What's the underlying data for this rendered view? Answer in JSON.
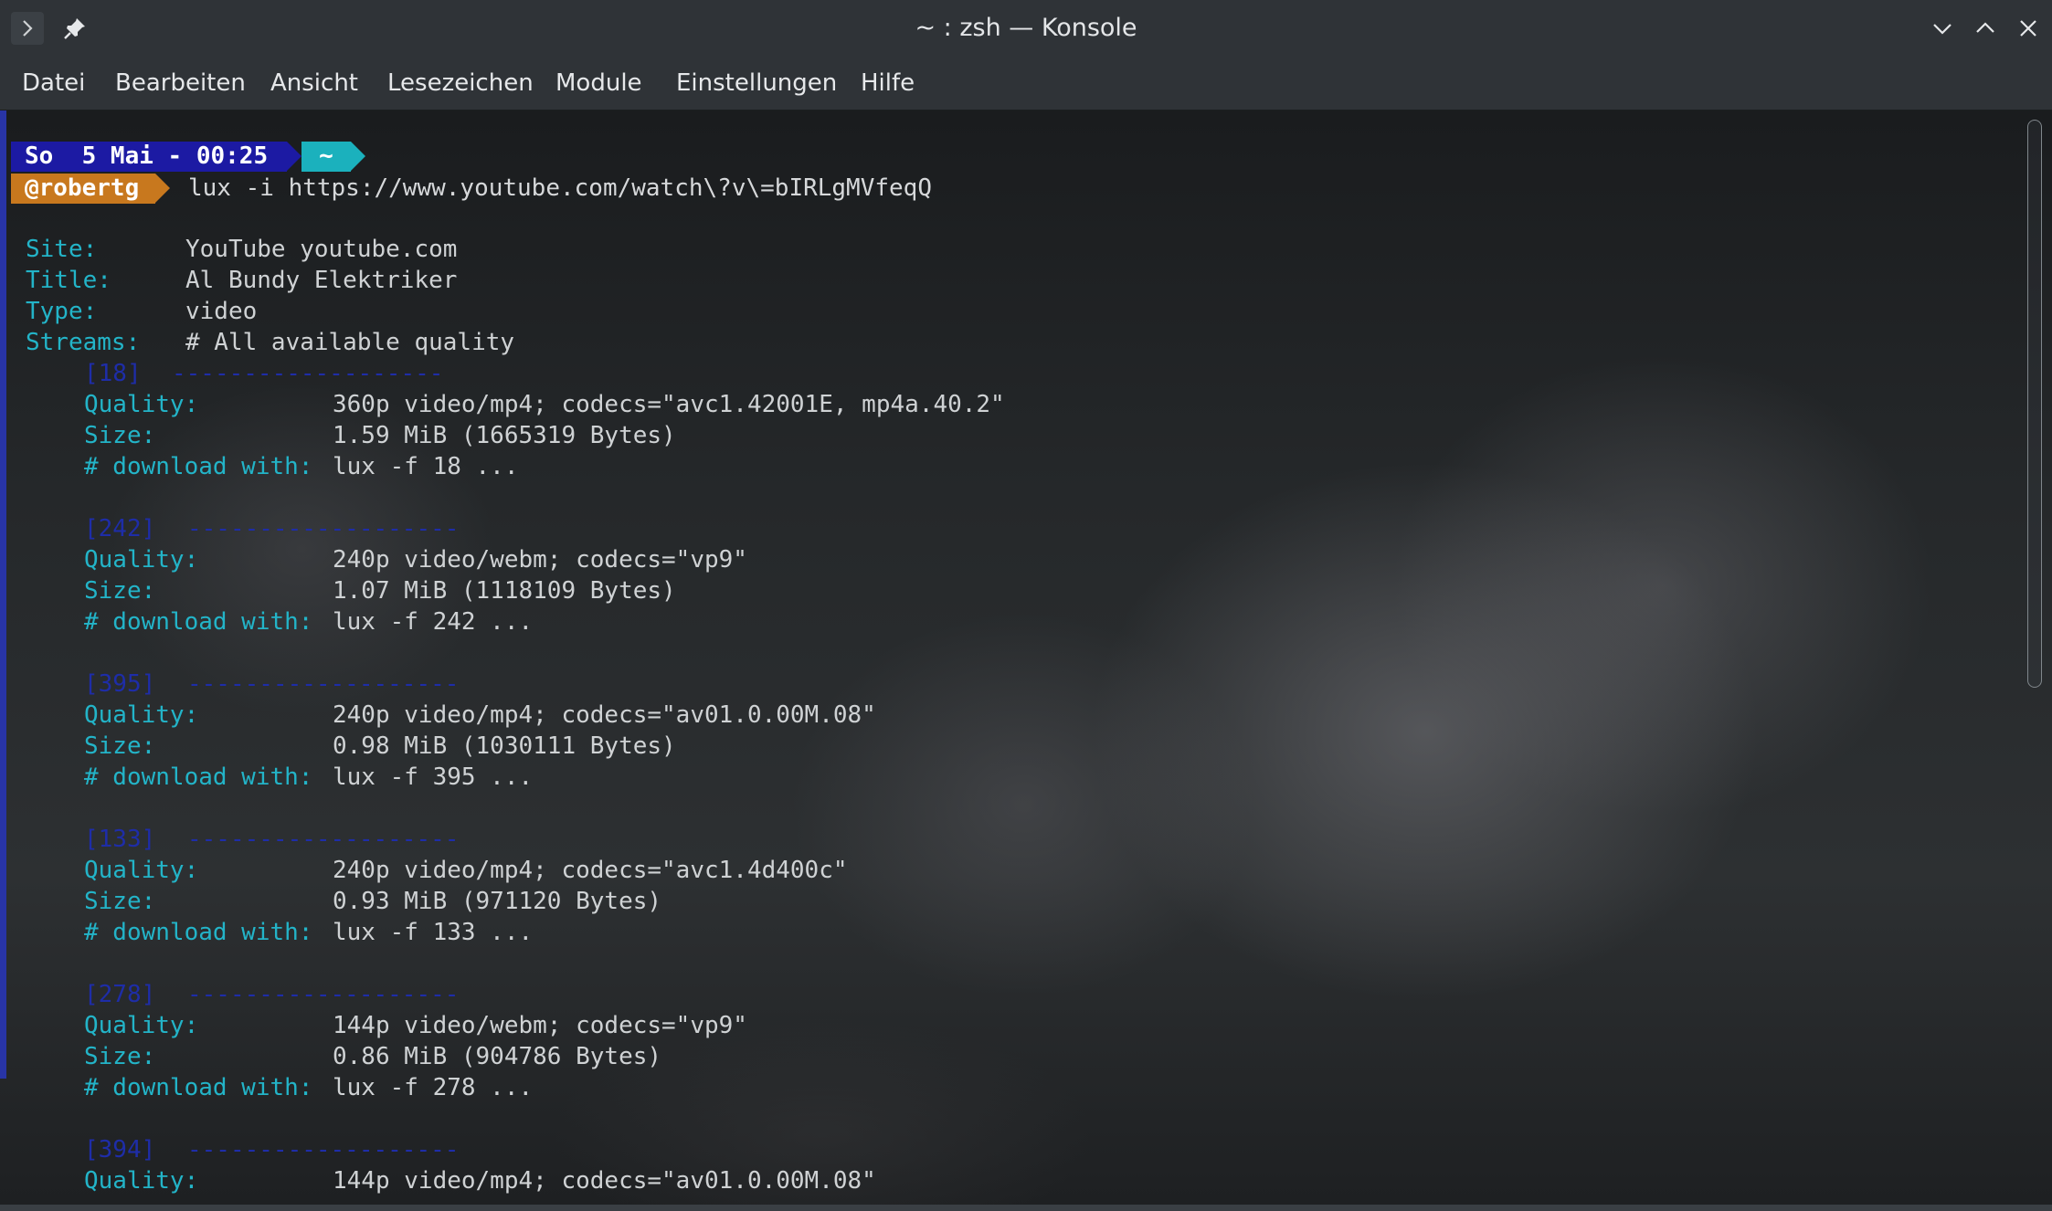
{
  "window": {
    "title": "~ : zsh — Konsole",
    "left_icons": [
      "terminal-menu-icon",
      "pin-icon"
    ],
    "right_icons": [
      "minimize-icon",
      "maximize-icon",
      "close-icon"
    ]
  },
  "menubar": {
    "items": [
      "Datei",
      "Bearbeiten",
      "Ansicht",
      "Lesezeichen",
      "Module",
      "Einstellungen",
      "Hilfe"
    ]
  },
  "prompt": {
    "datetime": "So  5 Mai - 00:25",
    "dir": "~",
    "user": "@robertg",
    "command": "lux -i https://www.youtube.com/watch\\?v\\=bIRLgMVfeqQ"
  },
  "info": [
    {
      "label": "Site:",
      "value": "YouTube youtube.com"
    },
    {
      "label": "Title:",
      "value": "Al Bundy Elektriker"
    },
    {
      "label": "Type:",
      "value": "video"
    },
    {
      "label": "Streams:",
      "value": "# All available quality"
    }
  ],
  "stream_labels": {
    "quality": "Quality:",
    "size": "Size:",
    "download": "# download with:"
  },
  "streams": [
    {
      "id": "[18]",
      "separator": "-------------------",
      "quality": "360p video/mp4; codecs=\"avc1.42001E, mp4a.40.2\"",
      "size": "1.59 MiB (1665319 Bytes)",
      "download": "lux -f 18 ..."
    },
    {
      "id": "[242]",
      "separator": "-------------------",
      "quality": "240p video/webm; codecs=\"vp9\"",
      "size": "1.07 MiB (1118109 Bytes)",
      "download": "lux -f 242 ..."
    },
    {
      "id": "[395]",
      "separator": "-------------------",
      "quality": "240p video/mp4; codecs=\"av01.0.00M.08\"",
      "size": "0.98 MiB (1030111 Bytes)",
      "download": "lux -f 395 ..."
    },
    {
      "id": "[133]",
      "separator": "-------------------",
      "quality": "240p video/mp4; codecs=\"avc1.4d400c\"",
      "size": "0.93 MiB (971120 Bytes)",
      "download": "lux -f 133 ..."
    },
    {
      "id": "[278]",
      "separator": "-------------------",
      "quality": "144p video/webm; codecs=\"vp9\"",
      "size": "0.86 MiB (904786 Bytes)",
      "download": "lux -f 278 ..."
    },
    {
      "id": "[394]",
      "separator": "-------------------",
      "quality": "144p video/mp4; codecs=\"av01.0.00M.08\""
    }
  ],
  "colors": {
    "label": "#23b4c8",
    "stream_id": "#1e2da8",
    "text": "#cfd2d4",
    "prompt_date_bg": "#1c1aa3",
    "prompt_dir_bg": "#1bb1bd",
    "prompt_user_bg": "#c8781e"
  }
}
